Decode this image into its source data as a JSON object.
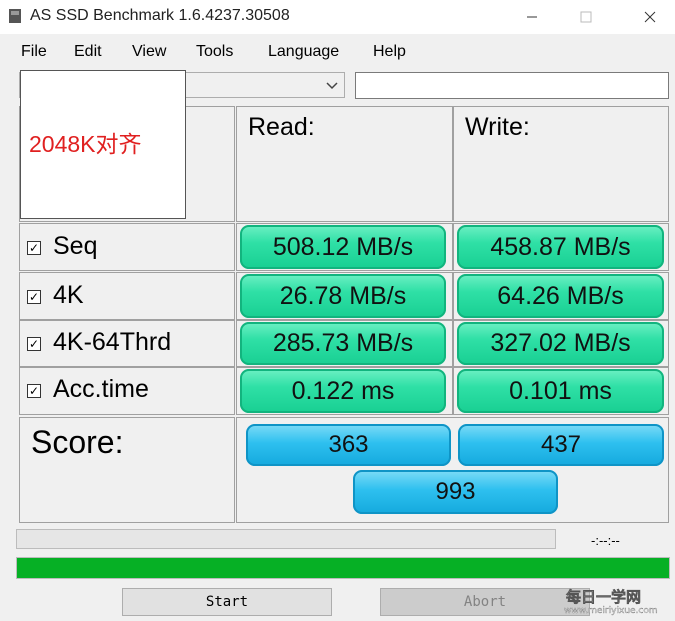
{
  "window": {
    "title": "AS SSD Benchmark 1.6.4237.30508"
  },
  "menu": [
    "File",
    "Edit",
    "View",
    "Tools",
    "Language",
    "Help"
  ],
  "overlay_text": "2048K对齐",
  "headers": {
    "read": "Read:",
    "write": "Write:"
  },
  "rows": [
    {
      "label": "Seq",
      "checked": true,
      "read": "508.12 MB/s",
      "write": "458.87 MB/s"
    },
    {
      "label": "4K",
      "checked": true,
      "read": "26.78 MB/s",
      "write": "64.26 MB/s"
    },
    {
      "label": "4K-64Thrd",
      "checked": true,
      "read": "285.73 MB/s",
      "write": "327.02 MB/s"
    },
    {
      "label": "Acc.time",
      "checked": true,
      "read": "0.122 ms",
      "write": "0.101 ms"
    }
  ],
  "score": {
    "label": "Score:",
    "read": "363",
    "write": "437",
    "total": "993"
  },
  "elapsed_time": "-:--:--",
  "progress": {
    "test_progress": 0,
    "overall_progress": 1.0
  },
  "buttons": {
    "start": "Start",
    "abort": "Abort"
  },
  "watermark": {
    "line1": "每日一学网",
    "line2": "www.meiriyixue.com"
  },
  "colors": {
    "result_green": "#2fe0a6",
    "score_blue": "#2ec0ef",
    "progress_green": "#06b025"
  }
}
